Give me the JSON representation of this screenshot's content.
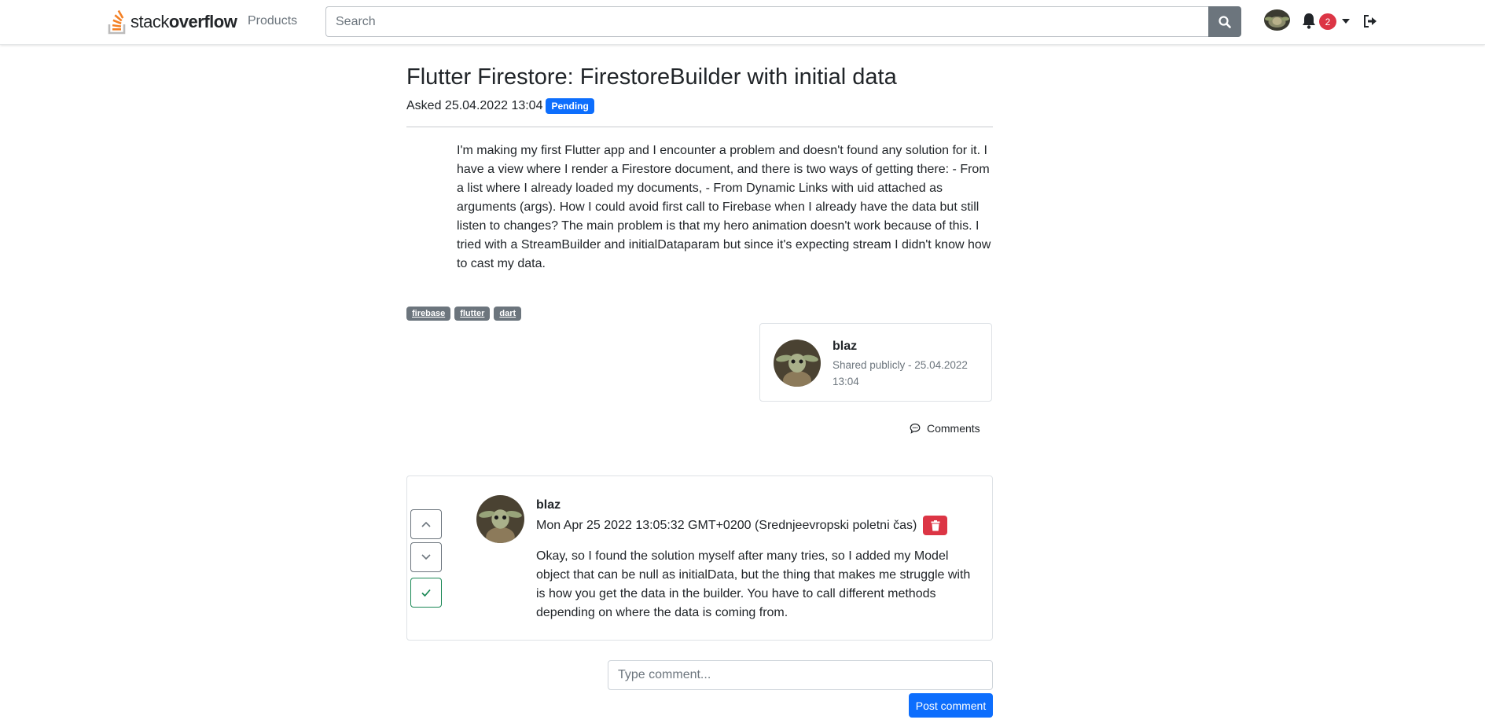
{
  "header": {
    "logo_light": "stack",
    "logo_bold": "overflow",
    "products_label": "Products",
    "search_placeholder": "Search",
    "notification_count": "2"
  },
  "question": {
    "title": "Flutter Firestore: FirestoreBuilder with initial data",
    "asked": "Asked 25.04.2022 13:04",
    "status": "Pending",
    "body": "I'm making my first Flutter app and I encounter a problem and doesn't found any solution for it. I have a view where I render a Firestore document, and there is two ways of getting there: - From a list where I already loaded my documents, - From Dynamic Links with uid attached as arguments (args). How I could avoid first call to Firebase when I already have the data but still listen to changes? The main problem is that my hero animation doesn't work because of this. I tried with a StreamBuilder and initialDataparam but since it's expecting stream I didn't know how to cast my data.",
    "tags": [
      "firebase",
      "flutter",
      "dart"
    ],
    "author": {
      "name": "blaz",
      "shared": "Shared publicly - 25.04.2022 13:04"
    },
    "comments_label": "Comments"
  },
  "answer": {
    "author": "blaz",
    "date": "Mon Apr 25 2022 13:05:32 GMT+0200 (Srednjeevropski poletni čas)",
    "body": "Okay, so I found the solution myself after many tries, so I added my Model object that can be null as initialData, but the thing that makes me struggle with is how you get the data in the builder. You have to call different methods depending on where the data is coming from."
  },
  "comment_form": {
    "placeholder": "Type comment...",
    "post_label": "Post comment"
  },
  "colors": {
    "primary": "#0d6efd",
    "danger": "#dc3545",
    "secondary": "#6c757d",
    "success": "#198754",
    "logo_orange": "#f48024"
  },
  "icons": [
    "stackoverflow-logo-icon",
    "search-icon",
    "bell-icon",
    "caret-down-icon",
    "logout-icon",
    "comment-icon",
    "chevron-up-icon",
    "chevron-down-icon",
    "check-icon",
    "trash-icon"
  ]
}
